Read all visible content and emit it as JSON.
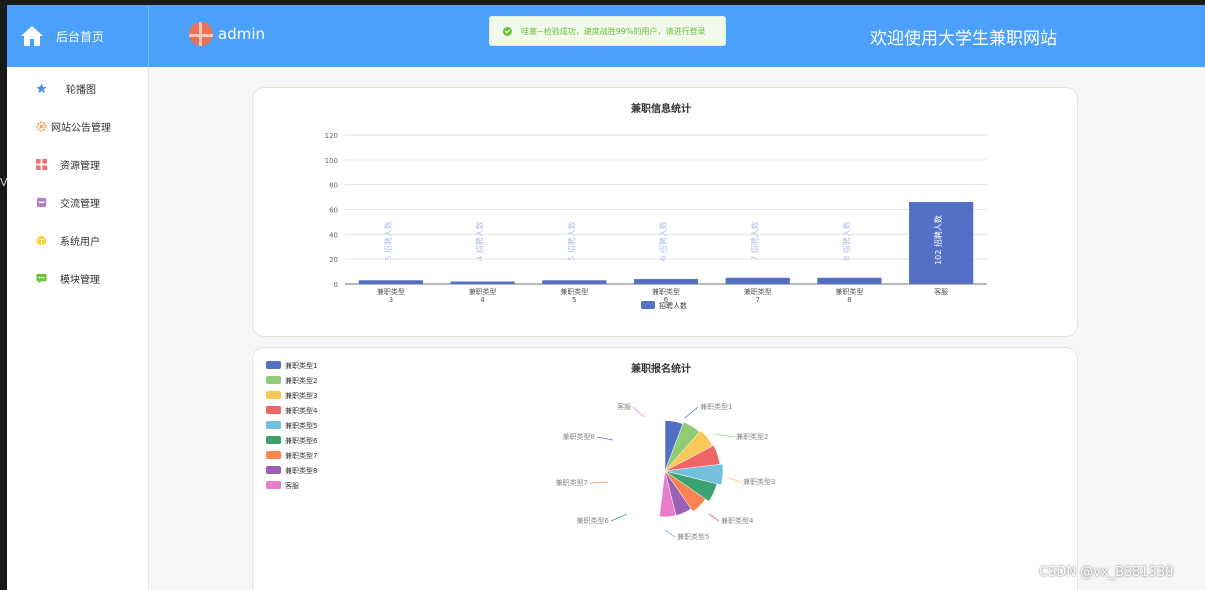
{
  "header": {
    "home_label": "后台首页",
    "username": "admin",
    "toast_message": "哇塞~检验成功，速度战胜99%的用户，请进行登录",
    "welcome": "欢迎使用大学生兼职网站"
  },
  "sidebar": {
    "items": [
      {
        "label": "轮播图",
        "icon": "star-icon",
        "color": "#4a90e2"
      },
      {
        "label": "网站公告管理",
        "icon": "gear-icon",
        "color": "#f5a86b"
      },
      {
        "label": "资源管理",
        "icon": "grid-icon",
        "color": "#f56c6c"
      },
      {
        "label": "交流管理",
        "icon": "box-icon",
        "color": "#b07fc6"
      },
      {
        "label": "系统用户",
        "icon": "cube-icon",
        "color": "#f7d336"
      },
      {
        "label": "模块管理",
        "icon": "chat-icon",
        "color": "#67c23a"
      }
    ]
  },
  "charts": {
    "bar_title": "兼职信息统计",
    "pie_title": "兼职报名统计"
  },
  "chart_data": [
    {
      "type": "bar",
      "title": "兼职信息统计",
      "categories": [
        "兼职类型3",
        "兼职类型4",
        "兼职类型5",
        "兼职类型6",
        "兼职类型7",
        "兼职类型8",
        "客服"
      ],
      "tick_labels": [
        [
          "兼职类型",
          "3"
        ],
        [
          "兼职类型",
          "4"
        ],
        [
          "兼职类型",
          "5"
        ],
        [
          "兼职类型",
          "6"
        ],
        [
          "兼职类型",
          "7"
        ],
        [
          "兼职类型",
          "8"
        ],
        [
          "客服"
        ]
      ],
      "series": [
        {
          "name": "招聘人数",
          "values": [
            3,
            2,
            3,
            4,
            5,
            5,
            66
          ],
          "labels": [
            "5",
            "4",
            "5",
            "6",
            "7",
            "8",
            "102"
          ],
          "color": "#5470c6"
        }
      ],
      "bar_label_suffix": "招聘人数",
      "ylim": [
        0,
        120
      ],
      "yticks": [
        0,
        20,
        40,
        60,
        80,
        100,
        120
      ],
      "grid": true,
      "legend_position": "bottom"
    },
    {
      "type": "pie",
      "title": "兼职报名统计",
      "categories": [
        "兼职类型1",
        "兼职类型2",
        "兼职类型3",
        "兼职类型4",
        "兼职类型5",
        "兼职类型6",
        "兼职类型7",
        "兼职类型8",
        "客服"
      ],
      "values": [
        1,
        1,
        1,
        1,
        1,
        1,
        1,
        1,
        1
      ],
      "radius_fractions": [
        0.87,
        0.9,
        0.93,
        0.95,
        1.0,
        0.92,
        0.85,
        0.79,
        0.79
      ],
      "colors": [
        "#5470c6",
        "#91cc75",
        "#fac858",
        "#ee6666",
        "#73c0de",
        "#3ba272",
        "#fc8452",
        "#9a60b4",
        "#ea7ccc"
      ],
      "legend_position": "top-left"
    }
  ],
  "watermark": "CSDN @vx_BS81330"
}
